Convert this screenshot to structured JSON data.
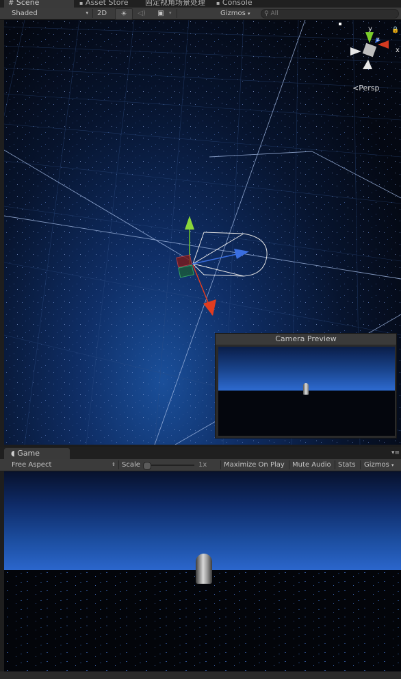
{
  "tabs": [
    {
      "label": "Scene",
      "icon": "grid-icon"
    },
    {
      "label": "Asset Store",
      "icon": "store-icon"
    },
    {
      "label": "固定视角场景处理",
      "icon": ""
    },
    {
      "label": "Console",
      "icon": "console-icon"
    }
  ],
  "scene_toolbar": {
    "shading_mode": "Shaded",
    "mode_2d": "2D",
    "gizmos": "Gizmos",
    "search_placeholder": "All"
  },
  "scene_gizmo": {
    "y": "y",
    "z": "z",
    "x": "x",
    "projection": "Persp"
  },
  "camera_preview": {
    "title": "Camera Preview"
  },
  "game_panel": {
    "tab": "Game",
    "aspect": "Free Aspect",
    "scale_label": "Scale",
    "scale_value": "1x",
    "maximize": "Maximize On Play",
    "mute": "Mute Audio",
    "stats": "Stats",
    "gizmos": "Gizmos"
  },
  "colors": {
    "sky_blue": "#1c4ea0",
    "ground": "#03050a",
    "axis_x": "#e03c20",
    "axis_y": "#7acc2a",
    "axis_z": "#3a6ee0"
  }
}
